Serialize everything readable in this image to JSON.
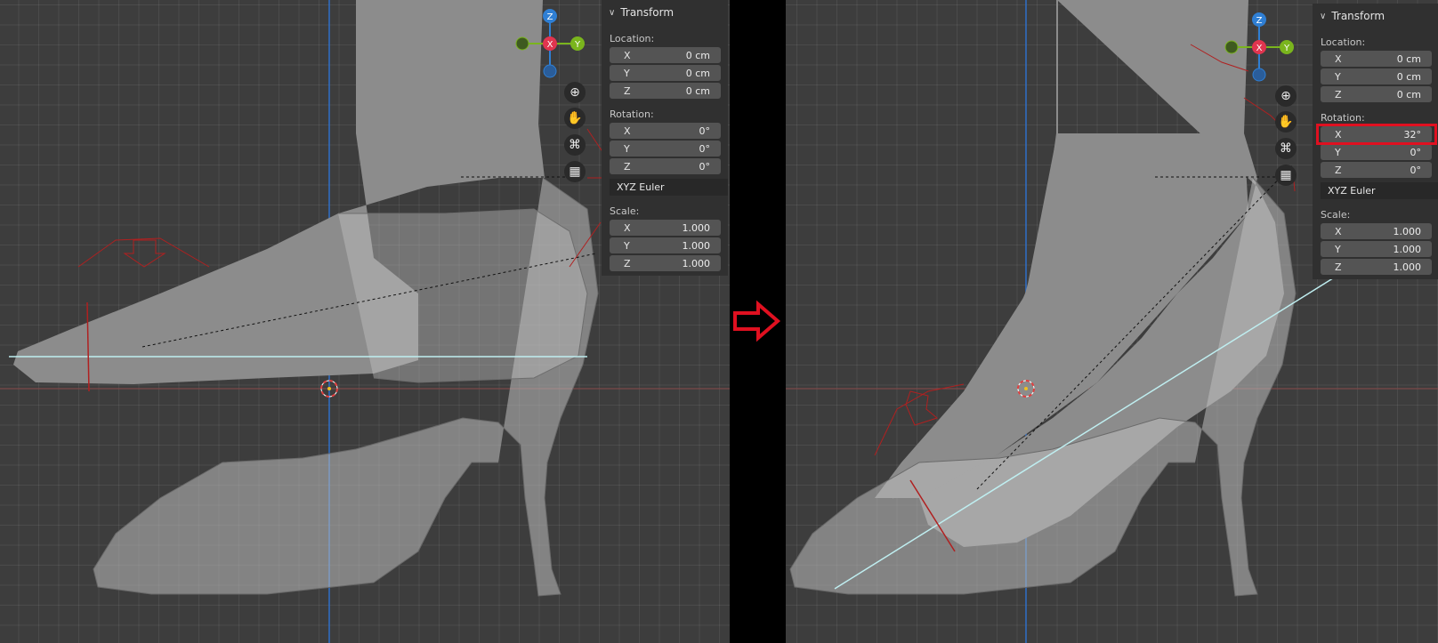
{
  "left": {
    "transform": {
      "title": "Transform",
      "location_label": "Location:",
      "location": [
        {
          "axis": "X",
          "value": "0 cm"
        },
        {
          "axis": "Y",
          "value": "0 cm"
        },
        {
          "axis": "Z",
          "value": "0 cm"
        }
      ],
      "rotation_label": "Rotation:",
      "rotation": [
        {
          "axis": "X",
          "value": "0°"
        },
        {
          "axis": "Y",
          "value": "0°"
        },
        {
          "axis": "Z",
          "value": "0°"
        }
      ],
      "rotation_mode": "XYZ Euler",
      "scale_label": "Scale:",
      "scale": [
        {
          "axis": "X",
          "value": "1.000"
        },
        {
          "axis": "Y",
          "value": "1.000"
        },
        {
          "axis": "Z",
          "value": "1.000"
        }
      ]
    }
  },
  "right": {
    "transform": {
      "title": "Transform",
      "location_label": "Location:",
      "location": [
        {
          "axis": "X",
          "value": "0 cm"
        },
        {
          "axis": "Y",
          "value": "0 cm"
        },
        {
          "axis": "Z",
          "value": "0 cm"
        }
      ],
      "rotation_label": "Rotation:",
      "rotation": [
        {
          "axis": "X",
          "value": "32°"
        },
        {
          "axis": "Y",
          "value": "0°"
        },
        {
          "axis": "Z",
          "value": "0°"
        }
      ],
      "rotation_mode": "XYZ Euler",
      "scale_label": "Scale:",
      "scale": [
        {
          "axis": "X",
          "value": "1.000"
        },
        {
          "axis": "Y",
          "value": "1.000"
        },
        {
          "axis": "Z",
          "value": "1.000"
        }
      ]
    }
  },
  "gizmo": {
    "z": "Z",
    "x": "X",
    "y": "Y"
  },
  "icons": [
    "zoom-icon",
    "hand-pan-icon",
    "camera-icon",
    "grid-icon",
    "chevron-down-icon",
    "arrow-right-icon",
    "3d-cursor-icon"
  ],
  "colors": {
    "gizmo_x": "#e0354f",
    "gizmo_y": "#7ab51d",
    "gizmo_z": "#2f7fd4",
    "highlight": "#e01020",
    "guide_line": "#bfeef0",
    "arrow": "#e01020"
  }
}
